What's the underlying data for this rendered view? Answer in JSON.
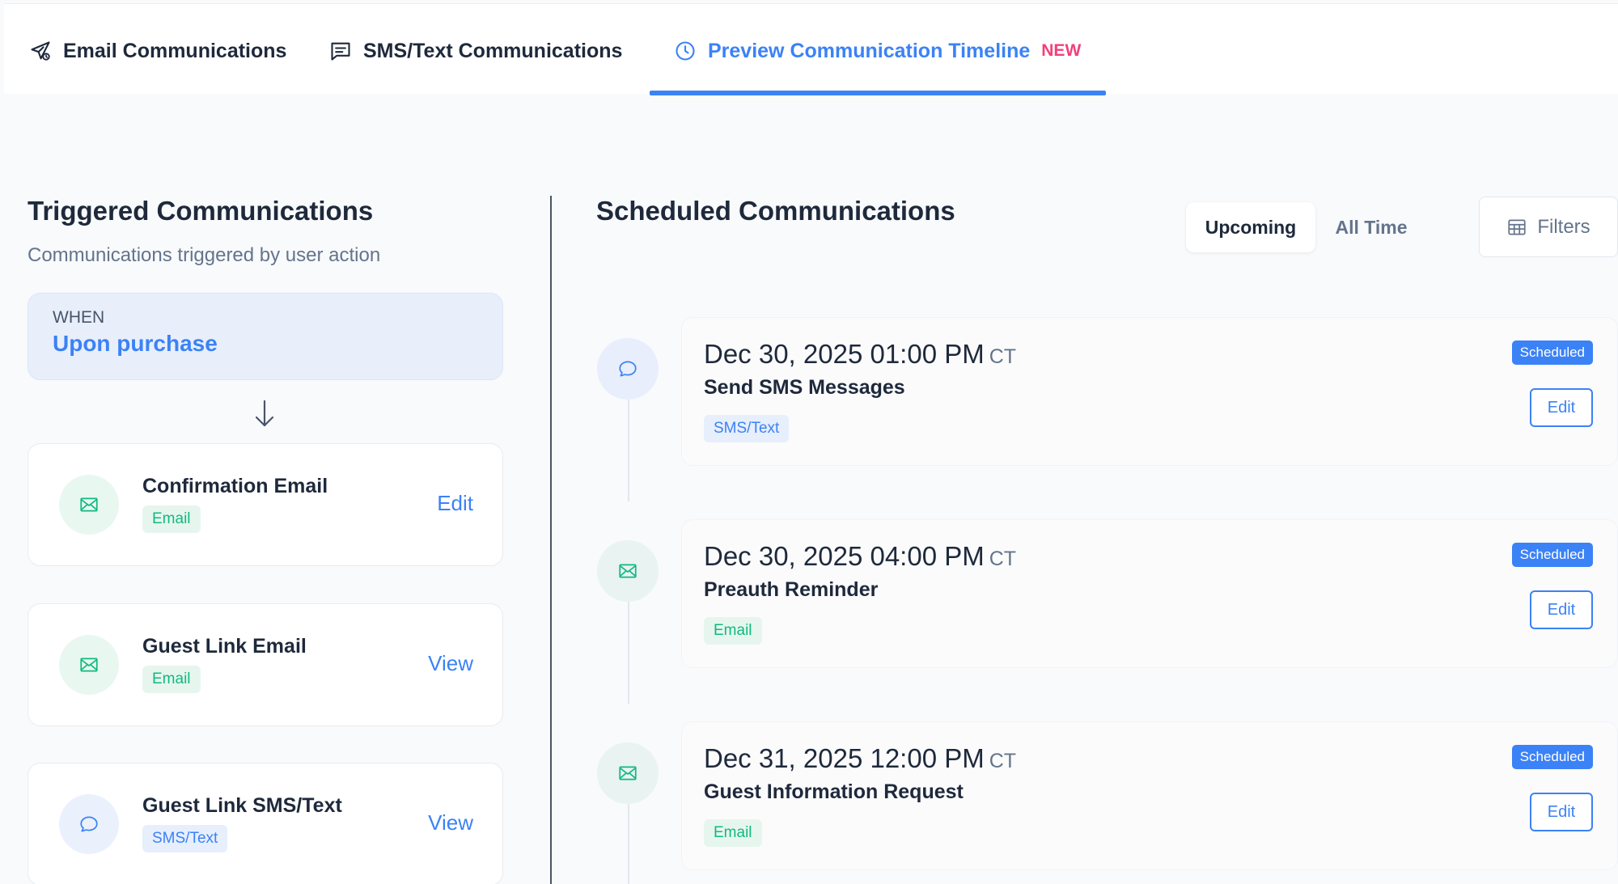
{
  "tabs": {
    "email": "Email Communications",
    "sms": "SMS/Text Communications",
    "timeline": "Preview Communication Timeline",
    "timeline_badge": "NEW"
  },
  "triggered": {
    "title": "Triggered Communications",
    "subtitle": "Communications triggered by user action",
    "when_label": "WHEN",
    "when_value": "Upon purchase",
    "items": [
      {
        "name": "Confirmation Email",
        "badge": "Email",
        "action": "Edit",
        "icon": "envelope-icon"
      },
      {
        "name": "Guest Link Email",
        "badge": "Email",
        "action": "View",
        "icon": "envelope-icon"
      },
      {
        "name": "Guest Link SMS/Text",
        "badge": "SMS/Text",
        "action": "View",
        "icon": "chat-bubble-icon"
      }
    ]
  },
  "scheduled": {
    "title": "Scheduled Communications",
    "segment_upcoming": "Upcoming",
    "segment_all_time": "All Time",
    "filters_label": "Filters",
    "items": [
      {
        "date": "Dec 30, 2025 01:00 PM",
        "tz": "CT",
        "name": "Send SMS Messages",
        "badge": "SMS/Text",
        "status": "Scheduled",
        "action": "Edit",
        "icon": "chat-bubble-icon"
      },
      {
        "date": "Dec 30, 2025 04:00 PM",
        "tz": "CT",
        "name": "Preauth Reminder",
        "badge": "Email",
        "status": "Scheduled",
        "action": "Edit",
        "icon": "envelope-icon"
      },
      {
        "date": "Dec 31, 2025 12:00 PM",
        "tz": "CT",
        "name": "Guest Information Request",
        "badge": "Email",
        "status": "Scheduled",
        "action": "Edit",
        "icon": "envelope-icon"
      }
    ]
  },
  "colors": {
    "accent": "#3b82f6",
    "email_green": "#10b981",
    "new_badge": "#f43f7a"
  }
}
